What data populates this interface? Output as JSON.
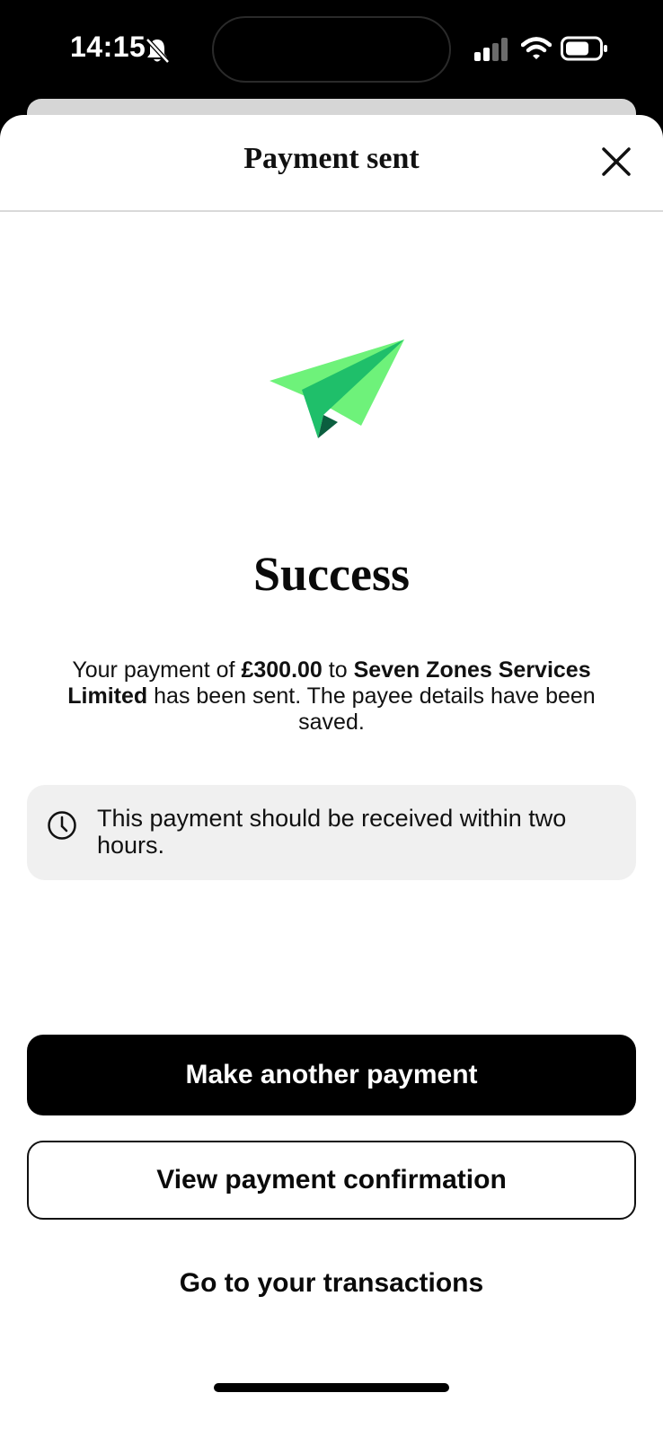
{
  "status_bar": {
    "time": "14:15",
    "icons": [
      "bell-muted-icon",
      "signal-icon",
      "wifi-icon",
      "battery-icon"
    ]
  },
  "header": {
    "title": "Payment sent",
    "close_icon": "close-icon"
  },
  "hero": {
    "icon": "paper-plane-icon",
    "colors": {
      "light": "#6ef27a",
      "mid": "#1fbf6a",
      "dark": "#0b5e3f"
    }
  },
  "main": {
    "title": "Success",
    "message": {
      "part1": "Your payment of ",
      "amount": "£300.00",
      "part2": " to ",
      "payee": "Seven Zones Services Limited",
      "part3": " has been sent. The payee details have been saved."
    },
    "info": {
      "icon": "clock-icon",
      "text": "This payment should be received within two hours."
    }
  },
  "actions": {
    "primary_label": "Make another payment",
    "secondary_label": "View payment confirmation",
    "link_label": "Go to your transactions"
  }
}
